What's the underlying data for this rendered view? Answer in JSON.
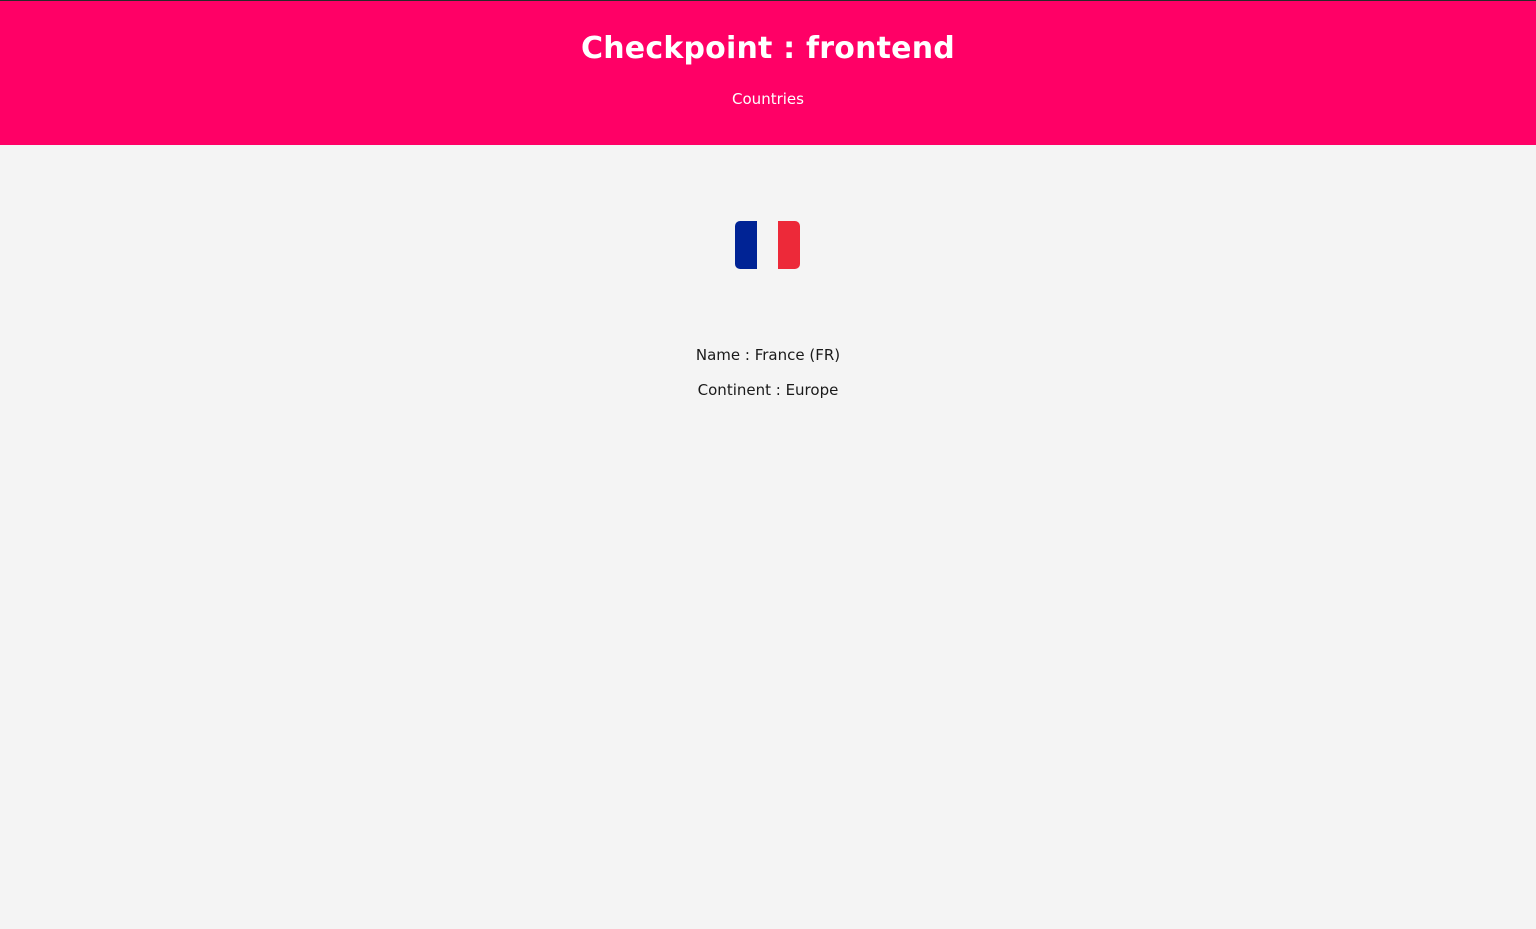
{
  "header": {
    "title": "Checkpoint : frontend",
    "nav_link": "Countries",
    "background_color": "#ff0066"
  },
  "country": {
    "flag_icon": "france-flag-icon",
    "flag_colors": [
      "#002395",
      "#f4f4f4",
      "#ed2939"
    ],
    "name_line": "Name : France (FR)",
    "continent_line": "Continent : Europe"
  }
}
